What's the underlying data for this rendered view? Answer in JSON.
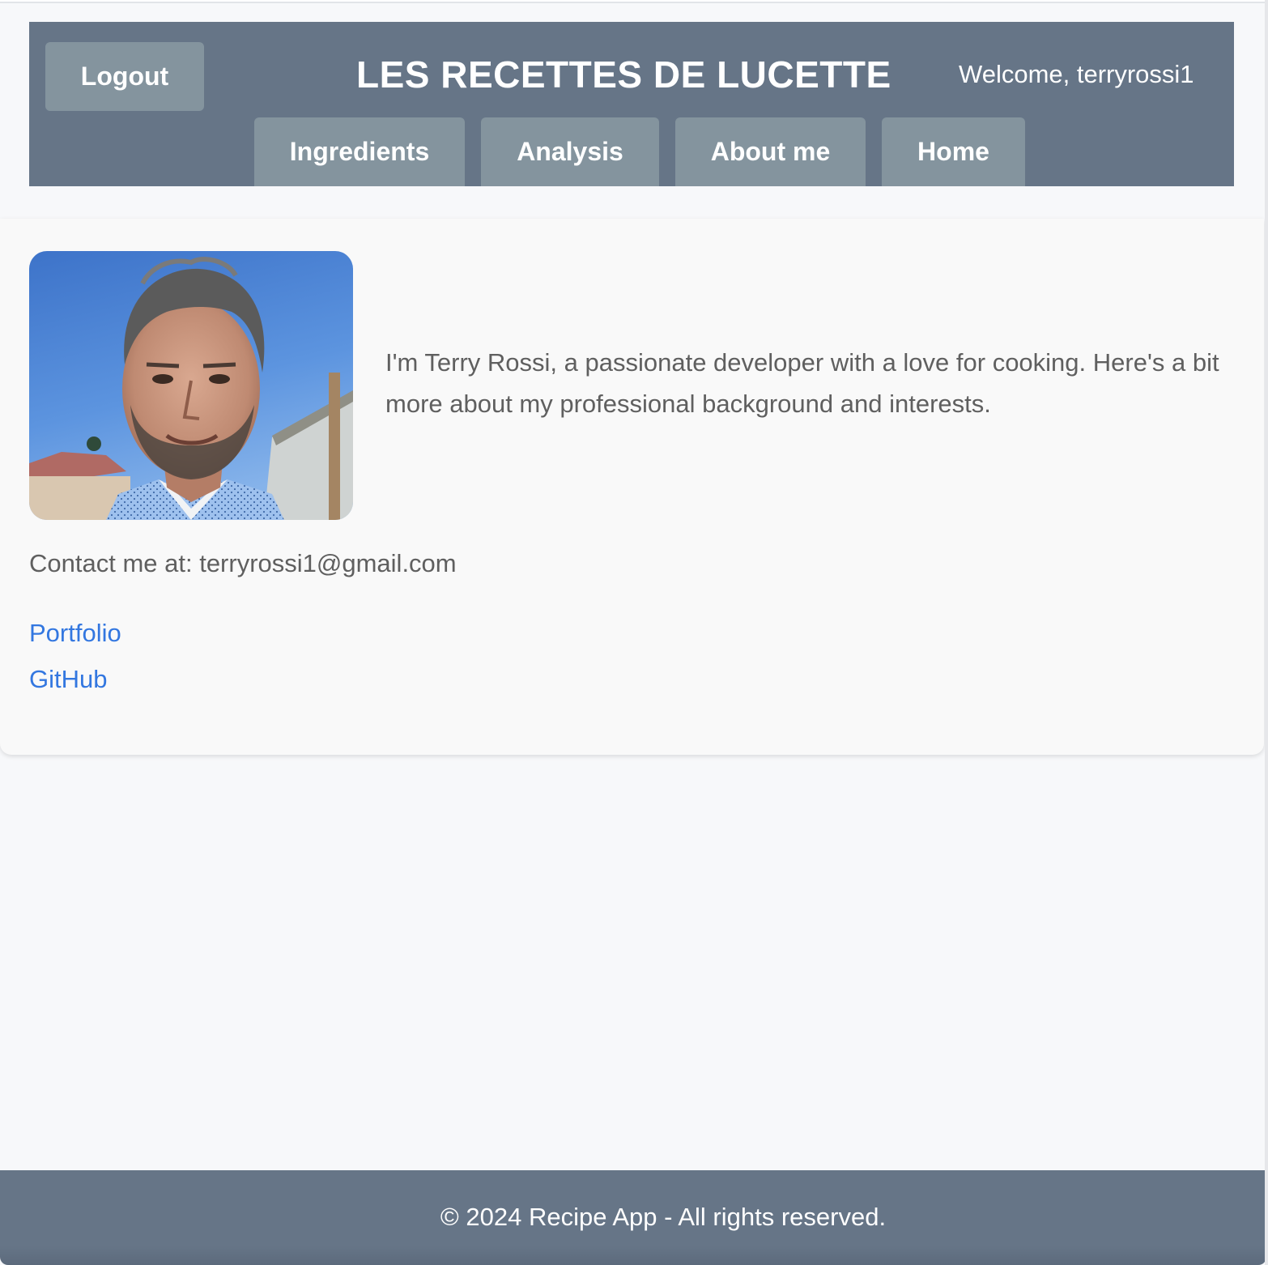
{
  "header": {
    "logout_label": "Logout",
    "site_title": "LES RECETTES DE LUCETTE",
    "welcome_text": "Welcome, terryrossi1",
    "nav": [
      {
        "label": "Ingredients"
      },
      {
        "label": "Analysis"
      },
      {
        "label": "About me"
      },
      {
        "label": "Home"
      }
    ]
  },
  "about": {
    "photo_alt": "Terry Rossi portrait",
    "bio": "I'm Terry Rossi, a passionate developer with a love for cooking. Here's a bit more about my professional background and interests.",
    "contact": "Contact me at: terryrossi1@gmail.com",
    "links": [
      {
        "label": "Portfolio"
      },
      {
        "label": "GitHub"
      }
    ]
  },
  "footer": {
    "text": "© 2024 Recipe App - All rights reserved."
  },
  "colors": {
    "header_bg": "#667587",
    "button_bg": "#84949e",
    "link": "#3377e0",
    "text": "#5f5f5f"
  }
}
